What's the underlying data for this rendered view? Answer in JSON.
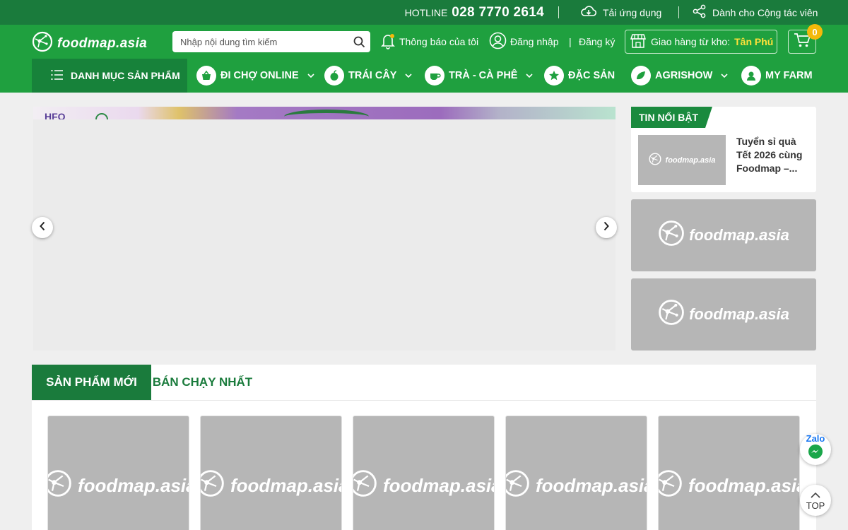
{
  "topbar": {
    "hotline_label": "HOTLINE",
    "hotline_number": "028 7770 2614",
    "download_app": "Tải ứng dụng",
    "collaborator": "Dành cho Cộng tác viên"
  },
  "header": {
    "logo_text": "foodmap.asia",
    "search_placeholder": "Nhập nội dung tìm kiếm",
    "notifications": "Thông báo của tôi",
    "login": "Đăng nhập",
    "separator": "|",
    "register": "Đăng ký",
    "warehouse_label": "Giao hàng từ kho:",
    "warehouse_store": "Tân Phú",
    "cart_count": "0"
  },
  "nav": {
    "category_button": "DANH MỤC SẢN PHẨM",
    "items": [
      {
        "label": "ĐI CHỢ ONLINE",
        "icon": "basket-icon",
        "dropdown": true
      },
      {
        "label": "TRÁI CÂY",
        "icon": "fruit-icon",
        "dropdown": true
      },
      {
        "label": "TRÀ - CÀ PHÊ",
        "icon": "coffee-icon",
        "dropdown": true
      },
      {
        "label": "ĐẶC SẢN",
        "icon": "specialty-icon",
        "dropdown": false
      },
      {
        "label": "AGRISHOW",
        "icon": "agrishow-icon",
        "dropdown": true
      },
      {
        "label": "MY FARM",
        "icon": "farm-icon",
        "dropdown": false
      }
    ]
  },
  "banner": {
    "strip_text": "HFO"
  },
  "news": {
    "tag": "TIN NỔI BẬT",
    "title": "Tuyển sỉ quà Tết 2026 cùng Foodmap –...",
    "thumb_logo": "foodmap.asia",
    "image_logo": "foodmap.asia"
  },
  "products": {
    "tabs": [
      "SẢN PHẨM MỚI",
      "BÁN CHẠY NHẤT"
    ],
    "card_logo": "foodmap.asia"
  },
  "floating": {
    "zalo": "Zalo",
    "top": "TOP"
  },
  "colors": {
    "dark_green": "#1a7b3c",
    "green": "#1fa03f",
    "accent_yellow": "#f4b90a",
    "placeholder_gray": "#b6b6b6"
  }
}
